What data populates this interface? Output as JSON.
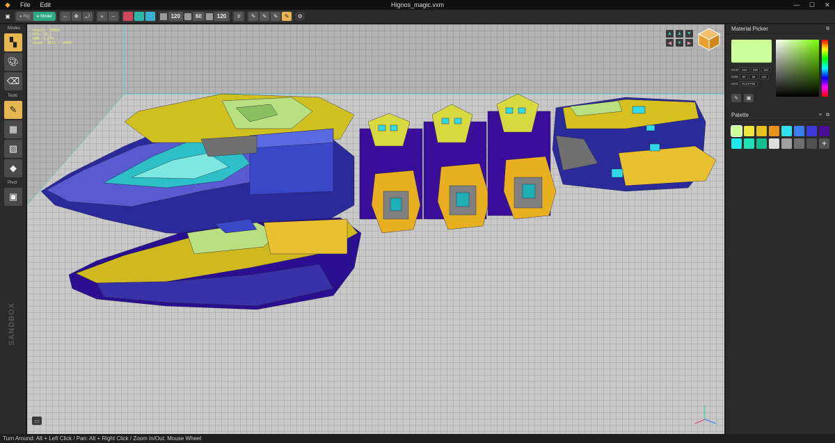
{
  "window": {
    "title": "Hignos_magic.vxm",
    "menu": [
      "File",
      "Edit"
    ],
    "controls": [
      "—",
      "☐",
      "✕"
    ]
  },
  "toolbar": {
    "mode_toggle": {
      "rig": "Rig",
      "model": "Model",
      "active": "Model"
    },
    "size_x": "120",
    "size_y": "60",
    "size_z": "120"
  },
  "left": {
    "modes_label": "Modes",
    "tools_label": "Tools",
    "pivot_label": "Pivot",
    "brand": "SANDBOX"
  },
  "viewport": {
    "stats": [
      "Voxels: 20084",
      "FPS: 52.1",
      "RAM: 1.67%",
      "Quads: 8111 / 10000"
    ]
  },
  "material_picker": {
    "title": "Material Picker",
    "color": "#ccff99",
    "rgb": [
      "204",
      "255",
      "153"
    ],
    "hsb": [
      "90",
      "39",
      "100"
    ],
    "hex": "#CCFF99",
    "labels": {
      "rgb": "RGB:",
      "hsb": "HSB:",
      "hex": "HEX:"
    }
  },
  "palette": {
    "title": "Palette",
    "colors": [
      "#ccff99",
      "#f0e640",
      "#e8c020",
      "#e8921a",
      "#30e0f0",
      "#3a7ef0",
      "#3a3ad8",
      "#4a0e9a",
      "#20e8e8",
      "#20e0b8",
      "#10c090",
      "#dcdcdc",
      "#a0a0a0",
      "#6e6e6e",
      "#505050"
    ]
  },
  "status": {
    "hint": "Turn Around: Alt + Left Click / Pan: Alt + Right Click / Zoom In/Out: Mouse Wheel"
  }
}
